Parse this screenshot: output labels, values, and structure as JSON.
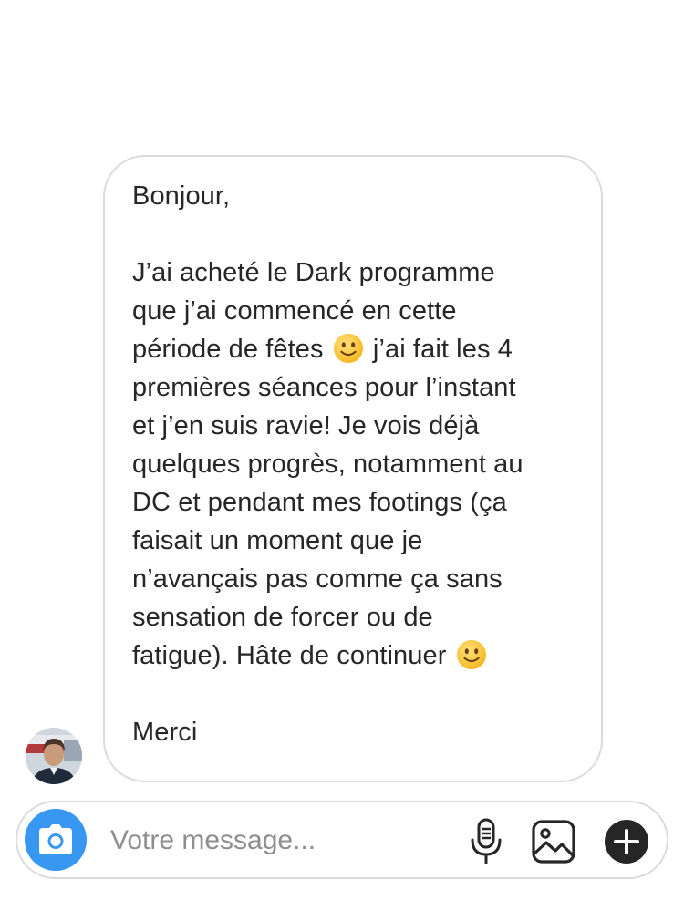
{
  "message": {
    "greeting": "Bonjour,",
    "body_lines": [
      "J’ai acheté le Dark programme",
      "que j’ai commencé en cette",
      "période de fêtes",
      " j’ai fait les 4",
      "premières séances pour l’instant",
      "et j’en suis ravie! Je vois déjà",
      "quelques progrès, notamment au",
      "DC et pendant mes footings (ça",
      "faisait un moment que je",
      "n’avançais pas comme ça sans",
      "sensation de forcer ou de",
      "fatigue). Hâte de continuer"
    ],
    "closing": "Merci",
    "emoji_icon": "slightly-smiling-face"
  },
  "composer": {
    "placeholder": "Votre message...",
    "camera_icon": "camera-icon",
    "mic_icon": "microphone-icon",
    "gallery_icon": "image-gallery-icon",
    "plus_icon": "plus-circle-icon"
  },
  "colors": {
    "accent": "#3897f0",
    "border": "#dbdbdb",
    "text": "#262626",
    "placeholder": "#8e8e8e",
    "emoji": "#ffcc33"
  }
}
